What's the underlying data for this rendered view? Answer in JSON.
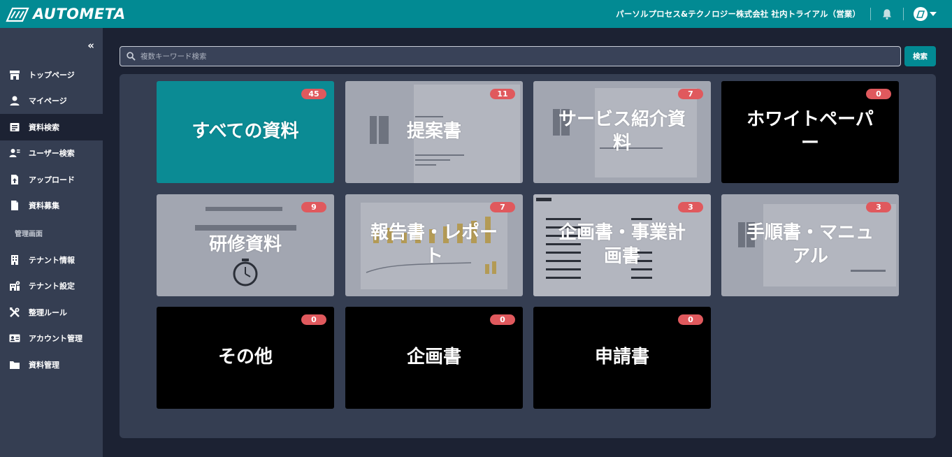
{
  "header": {
    "logo_text": "AUTOMETA",
    "company": "パーソルプロセス&テクノロジー株式会社 社内トライアル（営業）",
    "brand_color": "#028a93"
  },
  "sidebar": {
    "collapse_label": "«",
    "items": [
      {
        "label": "トップページ",
        "icon": "store-icon"
      },
      {
        "label": "マイページ",
        "icon": "user-icon"
      },
      {
        "label": "資料検索",
        "icon": "document-search-icon",
        "active": true
      },
      {
        "label": "ユーザー検索",
        "icon": "user-search-icon"
      },
      {
        "label": "アップロード",
        "icon": "upload-file-icon"
      },
      {
        "label": "資料募集",
        "icon": "file-icon"
      }
    ],
    "admin_section": "管理画面",
    "admin_items": [
      {
        "label": "テナント情報",
        "icon": "building-icon"
      },
      {
        "label": "テナント設定",
        "icon": "building-settings-icon"
      },
      {
        "label": "整理ルール",
        "icon": "tools-icon"
      },
      {
        "label": "アカウント管理",
        "icon": "id-card-icon"
      },
      {
        "label": "資料管理",
        "icon": "folder-icon"
      }
    ]
  },
  "search": {
    "placeholder": "複数キーワード検索",
    "button_label": "検索"
  },
  "categories": [
    {
      "title": "すべての資料",
      "count": "45",
      "style": "teal"
    },
    {
      "title": "提案書",
      "count": "11",
      "style": "thumb"
    },
    {
      "title": "サービス紹介資料",
      "count": "7",
      "style": "thumb"
    },
    {
      "title": "ホワイトペーパー",
      "count": "0",
      "style": "black"
    },
    {
      "title": "研修資料",
      "count": "9",
      "style": "thumb"
    },
    {
      "title": "報告書・レポート",
      "count": "7",
      "style": "thumb"
    },
    {
      "title": "企画書・事業計画書",
      "count": "3",
      "style": "thumb"
    },
    {
      "title": "手順書・マニュアル",
      "count": "3",
      "style": "thumb"
    },
    {
      "title": "その他",
      "count": "0",
      "style": "black"
    },
    {
      "title": "企画書",
      "count": "0",
      "style": "black"
    },
    {
      "title": "申請書",
      "count": "0",
      "style": "black"
    }
  ]
}
